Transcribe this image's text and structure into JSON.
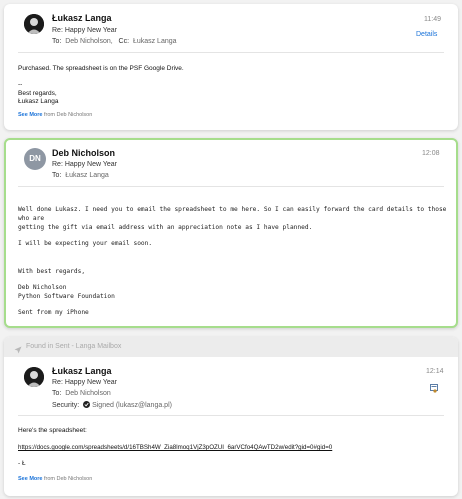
{
  "message1": {
    "sender": "Łukasz Langa",
    "subject": "Re: Happy New Year",
    "to_label": "To:",
    "to": "Deb Nicholson,",
    "cc_label": "Cc:",
    "cc": "Łukasz Langa",
    "time": "11:49",
    "details": "Details",
    "body_line1": "Purchased. The spreadsheet is on the PSF Google Drive.",
    "sig_dash": "--",
    "sig_line1": "Best regards,",
    "sig_line2": "Łukasz Langa",
    "see_more": "See More",
    "see_more_from": "from Deb Nicholson"
  },
  "message2": {
    "avatar_initials": "DN",
    "sender": "Deb Nicholson",
    "subject": "Re: Happy New Year",
    "to_label": "To:",
    "to": "Łukasz Langa",
    "time": "12:08",
    "body_line1": "Well done Lukasz. I need you to email the spreadsheet to me here. So I can easily forward the card details to those who are",
    "body_line2": "getting the gift via email address with an appreciation note as I have planned.",
    "body_line3": "I will be expecting your email soon.",
    "body_line4": "With best regards,",
    "body_line5": "Deb Nicholson",
    "body_line6": "Python Software Foundation",
    "body_line7": "Sent from my iPhone"
  },
  "message3": {
    "found_in": "Found in Sent - Langa Mailbox",
    "sender": "Łukasz Langa",
    "subject": "Re: Happy New Year",
    "to_label": "To:",
    "to": "Deb Nicholson",
    "security_label": "Security:",
    "security_value": "Signed (lukasz@langa.pl)",
    "time": "12:14",
    "body_line1": "Here's the spreadsheet:",
    "link": "https://docs.google.com/spreadsheets/d/16TBSh4W_Zia8lmoq1VjZ3pOZUI_6arVCfo4QAwTD2w/edit?gid=0#gid=0",
    "sign": "- Ł",
    "see_more": "See More",
    "see_more_from": "from Deb Nicholson"
  },
  "colors": {
    "accent": "#1a73d9",
    "highlight_border": "#a6dd8c",
    "avatar_dn": "#8e97a3"
  }
}
